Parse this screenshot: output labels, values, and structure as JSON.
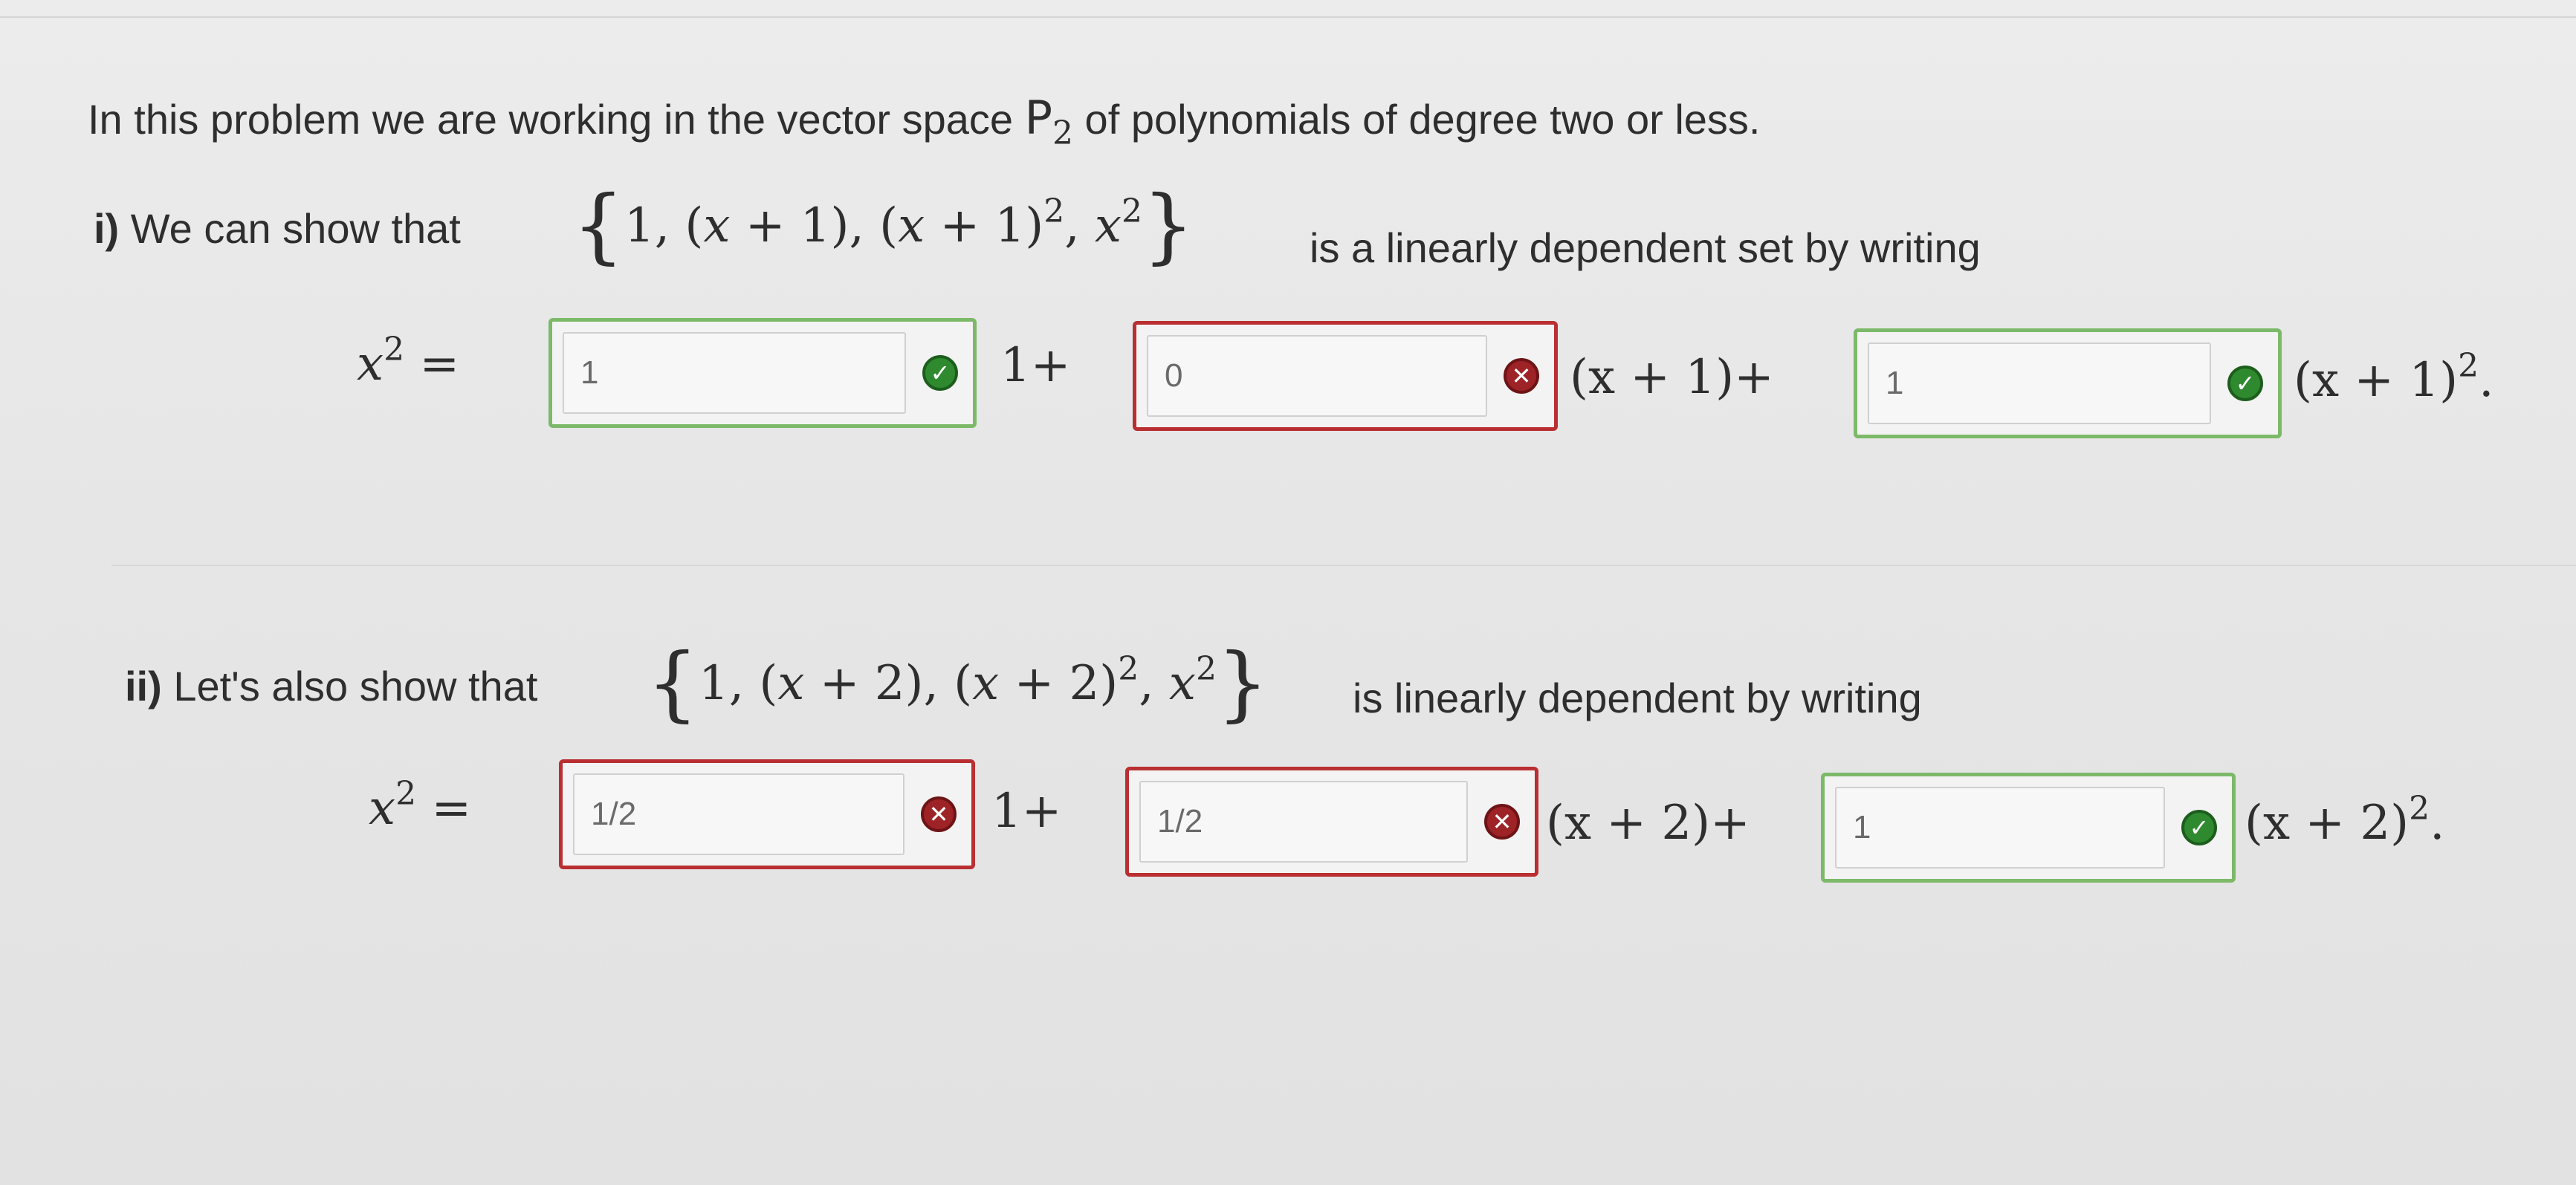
{
  "intro": {
    "prefix": "In this problem we are working in the vector space ",
    "space_symbol": "P",
    "space_sub": "2",
    "suffix": " of polynomials of degree two or less."
  },
  "part1": {
    "label": "i)",
    "text_before": " We can show that ",
    "set": {
      "open": "{",
      "e1": "1, (",
      "x": "x",
      "e2": " + 1), (",
      "e3": " + 1)",
      "sq": "2",
      "comma": ", ",
      "close": "}"
    },
    "text_after": "is a linearly dependent set by writing",
    "lhs": "x",
    "lhs_exp": "2",
    "equals": "=",
    "inputs": [
      {
        "value": "1",
        "status": "correct"
      },
      {
        "value": "0",
        "status": "incorrect"
      },
      {
        "value": "1",
        "status": "correct"
      }
    ],
    "terms": [
      "1+",
      "(x + 1)+",
      "(x + 1)"
    ],
    "last_exp": "2",
    "period": "."
  },
  "part2": {
    "label": "ii)",
    "text_before": " Let's also show that ",
    "set": {
      "open": "{",
      "e1": "1, (",
      "x": "x",
      "e2": " + 2), (",
      "e3": " + 2)",
      "sq": "2",
      "comma": ", ",
      "close": "}"
    },
    "text_after": "is linearly dependent by writing",
    "lhs": "x",
    "lhs_exp": "2",
    "equals": "=",
    "inputs": [
      {
        "value": "1/2",
        "status": "incorrect"
      },
      {
        "value": "1/2",
        "status": "incorrect"
      },
      {
        "value": "1",
        "status": "correct"
      }
    ],
    "terms": [
      "1+",
      "(x + 2)+",
      "(x + 2)"
    ],
    "last_exp": "2",
    "period": "."
  },
  "icons": {
    "correct": "check-icon",
    "incorrect": "x-icon"
  },
  "colors": {
    "correct_border": "#7cb968",
    "incorrect_border": "#b92f32",
    "correct_icon": "#2f8a2f",
    "incorrect_icon": "#9e2326"
  }
}
